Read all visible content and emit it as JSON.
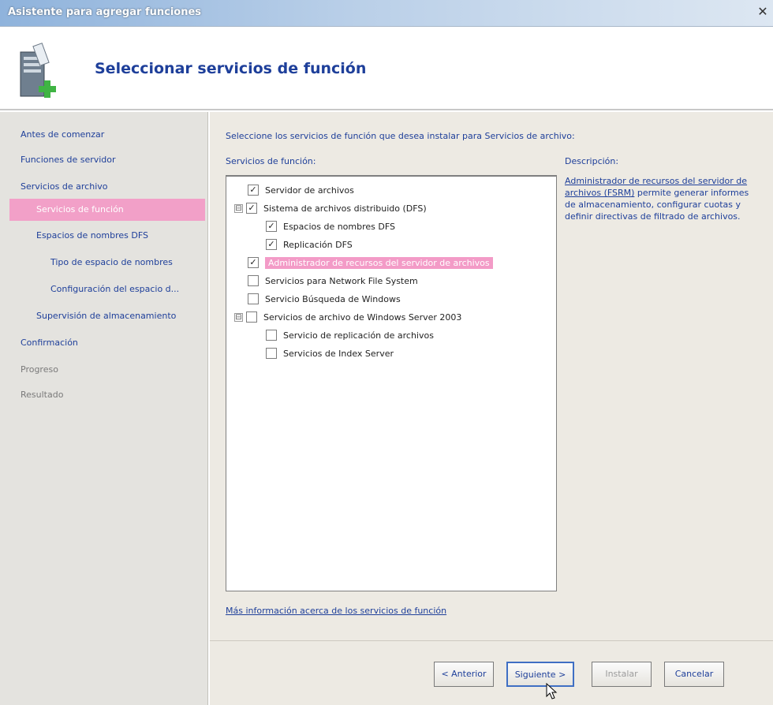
{
  "window": {
    "title": "Asistente para agregar funciones",
    "close_glyph": "✕"
  },
  "header": {
    "heading": "Seleccionar servicios de función",
    "icon": "server-add-icon"
  },
  "sidebar": {
    "items": [
      {
        "label": "Antes de comenzar"
      },
      {
        "label": "Funciones de servidor"
      },
      {
        "label": "Servicios de archivo"
      },
      {
        "label": "Servicios de función"
      },
      {
        "label": "Espacios de nombres DFS"
      },
      {
        "label": "Tipo de espacio de nombres"
      },
      {
        "label": "Configuración del espacio d..."
      },
      {
        "label": "Supervisión de almacenamiento"
      },
      {
        "label": "Confirmación"
      },
      {
        "label": "Progreso"
      },
      {
        "label": "Resultado"
      }
    ]
  },
  "main": {
    "instruction": "Seleccione los servicios de función que desea instalar para Servicios de archivo:",
    "services_label": "Servicios de función:",
    "description_label": "Descripción:",
    "tree": [
      {
        "label": "Servidor de archivos",
        "checked": true
      },
      {
        "label": "Sistema de archivos distribuido (DFS)",
        "checked": true,
        "expander": "⊟"
      },
      {
        "label": "Espacios de nombres DFS",
        "checked": true
      },
      {
        "label": "Replicación DFS",
        "checked": true
      },
      {
        "label": "Administrador de recursos del servidor de archivos",
        "checked": true,
        "selected": true
      },
      {
        "label": "Servicios para Network File System",
        "checked": false
      },
      {
        "label": "Servicio Búsqueda de Windows",
        "checked": false
      },
      {
        "label": "Servicios de archivo de Windows Server 2003",
        "checked": false,
        "expander": "⊟"
      },
      {
        "label": "Servicio de replicación de archivos",
        "checked": false
      },
      {
        "label": "Servicios de Index Server",
        "checked": false
      }
    ],
    "description": {
      "link": "Administrador de recursos del servidor de archivos (FSRM)",
      "text": " permite generar informes de almacenamiento, configurar cuotas y definir directivas de filtrado de archivos."
    },
    "more_info_link": "Más información acerca de los servicios de función"
  },
  "footer": {
    "back_label": "< Anterior",
    "next_label": "Siguiente >",
    "install_label": "Instalar",
    "cancel_label": "Cancelar"
  },
  "colors": {
    "accent": "#1e3f9a",
    "selection": "#f2a0c8",
    "sidebar_bg": "#e4e3df",
    "content_bg": "#edeae3"
  }
}
